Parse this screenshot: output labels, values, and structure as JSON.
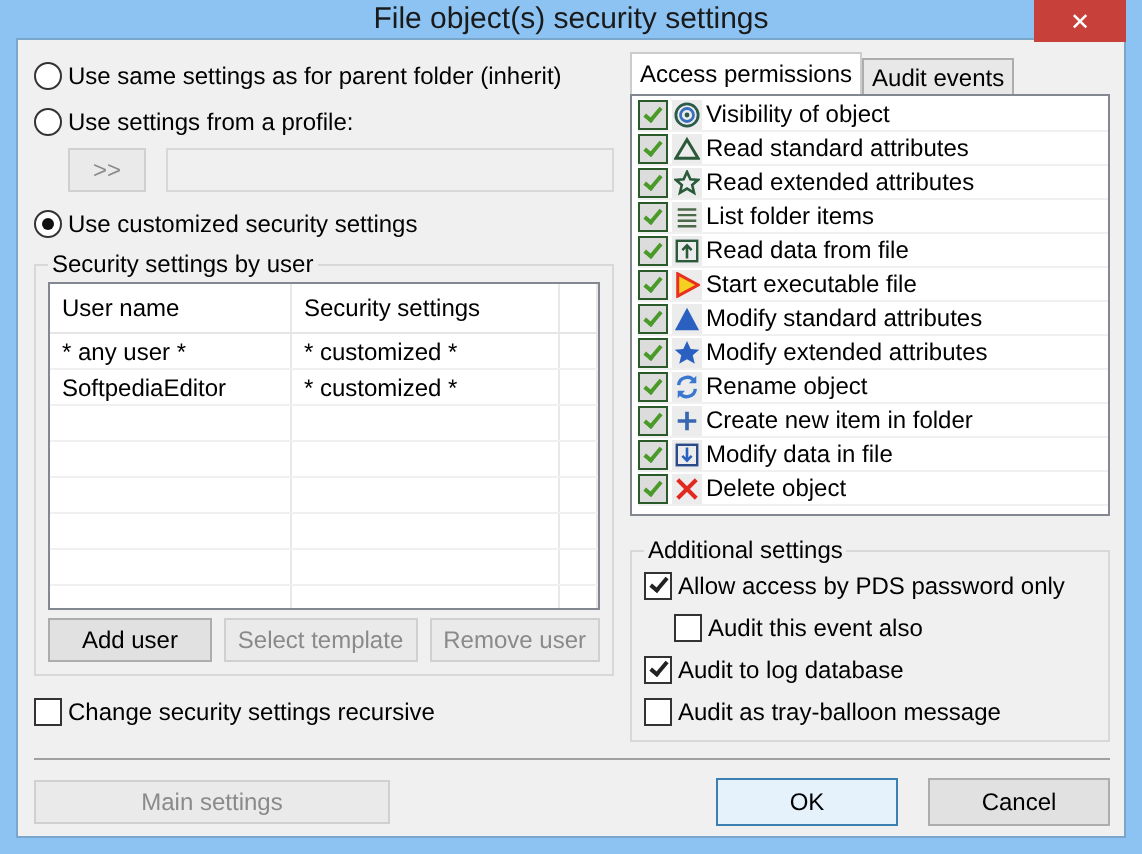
{
  "window": {
    "title": "File object(s) security settings",
    "close": "✕"
  },
  "modes": [
    {
      "label": "Use same settings as for parent folder (inherit)",
      "selected": false
    },
    {
      "label": "Use settings from a profile:",
      "selected": false
    },
    {
      "label": "Use customized security settings",
      "selected": true
    }
  ],
  "profile": {
    "button": ">>"
  },
  "users_group": {
    "title": "Security settings by user",
    "columns": [
      "User name",
      "Security settings"
    ],
    "rows": [
      [
        "* any user *",
        "* customized *"
      ],
      [
        "SoftpediaEditor",
        "* customized *"
      ]
    ],
    "buttons": [
      {
        "label": "Add user",
        "disabled": false
      },
      {
        "label": "Select template",
        "disabled": true
      },
      {
        "label": "Remove user",
        "disabled": true
      }
    ]
  },
  "recursive": {
    "label": "Change security settings recursive",
    "checked": false
  },
  "main_settings": {
    "label": "Main settings",
    "disabled": true
  },
  "tabs": [
    {
      "label": "Access permissions",
      "selected": true
    },
    {
      "label": "Audit events",
      "selected": false
    }
  ],
  "permissions": [
    {
      "kind": "target",
      "label": "Visibility of object",
      "checked": true
    },
    {
      "kind": "triangle-outline",
      "label": "Read standard attributes",
      "checked": true
    },
    {
      "kind": "star-outline",
      "label": "Read extended attributes",
      "checked": true
    },
    {
      "kind": "lines",
      "label": "List folder items",
      "checked": true
    },
    {
      "kind": "up-box",
      "label": "Read data from file",
      "checked": true
    },
    {
      "kind": "play",
      "label": "Start executable file",
      "checked": true
    },
    {
      "kind": "triangle",
      "label": "Modify standard attributes",
      "checked": true
    },
    {
      "kind": "star",
      "label": "Modify extended attributes",
      "checked": true
    },
    {
      "kind": "refresh",
      "label": "Rename object",
      "checked": true
    },
    {
      "kind": "plus",
      "label": "Create new item in folder",
      "checked": true
    },
    {
      "kind": "down-box",
      "label": "Modify data in file",
      "checked": true
    },
    {
      "kind": "cross",
      "label": "Delete object",
      "checked": true
    }
  ],
  "additional": {
    "title": "Additional settings",
    "options": [
      {
        "label": "Allow access by PDS password only",
        "checked": true,
        "indented": false
      },
      {
        "label": "Audit this event also",
        "checked": false,
        "indented": true
      },
      {
        "label": "Audit to log database",
        "checked": true,
        "indented": false
      },
      {
        "label": "Audit as tray-balloon message",
        "checked": false,
        "indented": false
      }
    ]
  },
  "buttons": [
    {
      "label": "OK",
      "default": true
    },
    {
      "label": "Cancel",
      "default": false
    }
  ]
}
